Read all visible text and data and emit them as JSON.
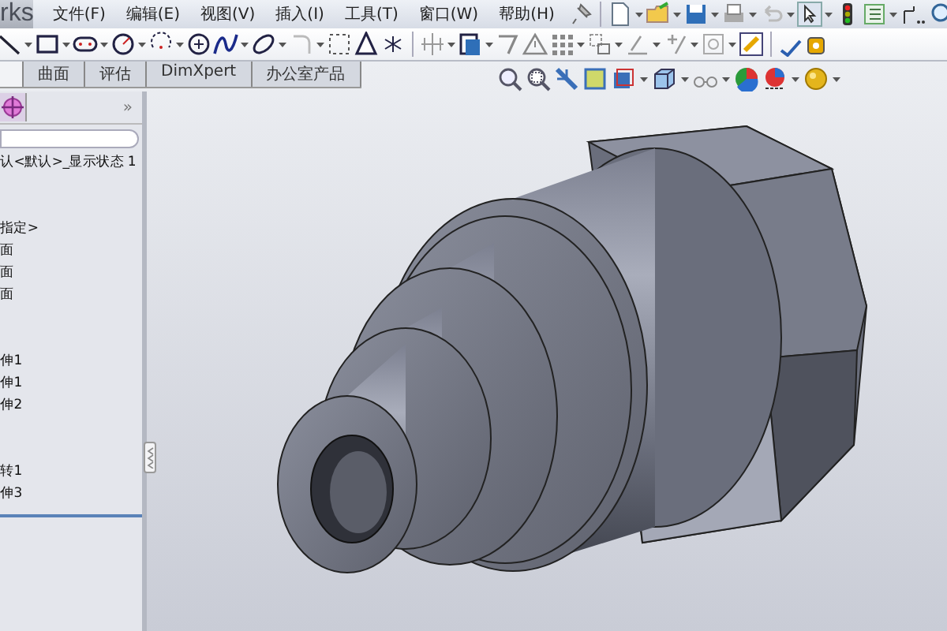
{
  "app": {
    "logo_text": "rks"
  },
  "menu": [
    "文件(F)",
    "编辑(E)",
    "视图(V)",
    "插入(I)",
    "工具(T)",
    "窗口(W)",
    "帮助(H)"
  ],
  "tabs": [
    {
      "label": "曲面",
      "selected": false
    },
    {
      "label": "评估",
      "selected": false
    },
    {
      "label": "DimXpert",
      "selected": false
    },
    {
      "label": "办公室产品",
      "selected": false
    }
  ],
  "panel": {
    "expand_glyph": "»",
    "title_text": "认<默认>_显示状态 1",
    "tree_groups": [
      [
        "指定>",
        "面",
        "面",
        "面"
      ],
      [
        "伸1",
        "伸1",
        "伸2"
      ],
      [
        "转1",
        "伸3"
      ]
    ]
  }
}
